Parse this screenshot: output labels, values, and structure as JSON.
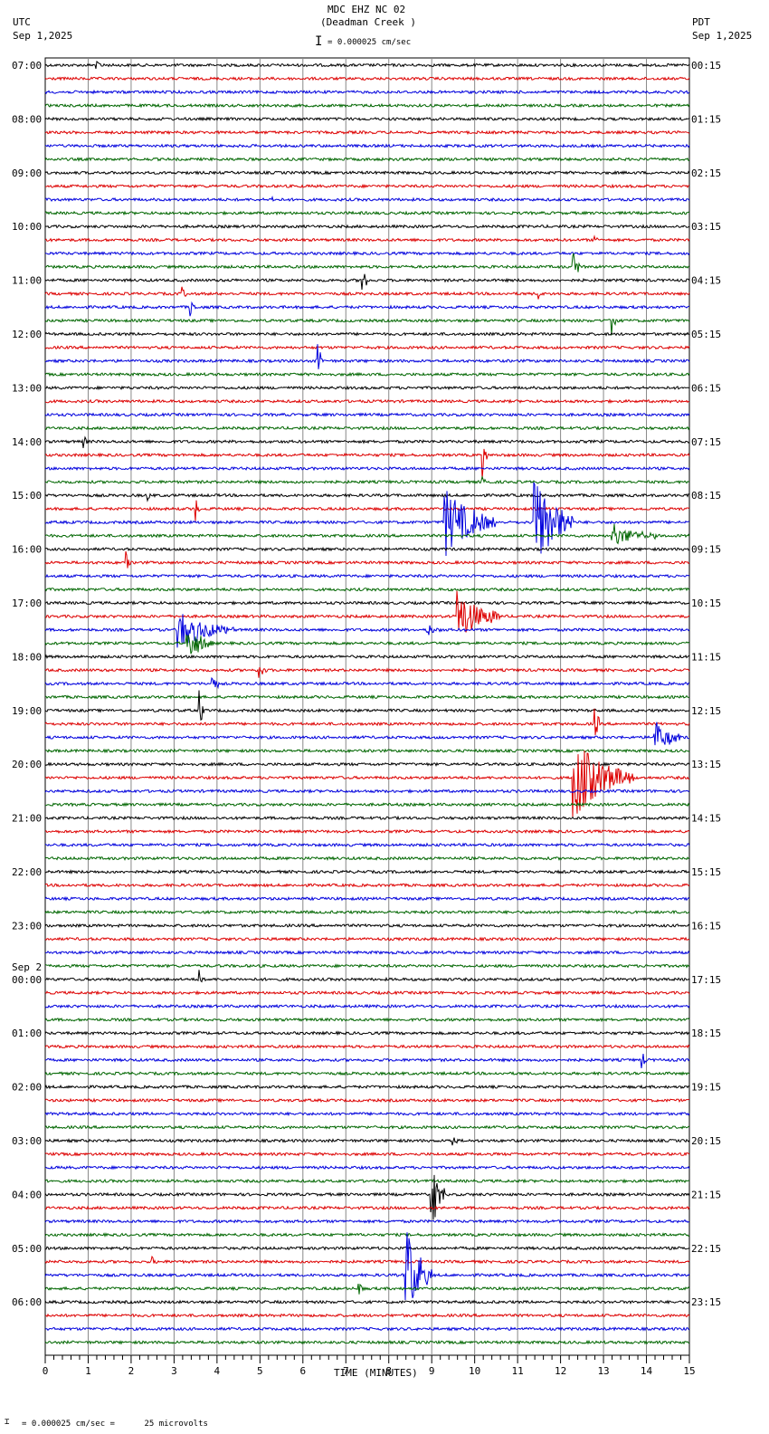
{
  "header": {
    "title": "MDC EHZ NC 02",
    "subtitle": "(Deadman Creek )",
    "scale": "= 0.000025 cm/sec",
    "left_tz": "UTC",
    "left_date": "Sep 1,2025",
    "right_tz": "PDT",
    "right_date": "Sep 1,2025"
  },
  "footer": {
    "scale": "= 0.000025 cm/sec =      25 microvolts"
  },
  "chart_data": {
    "type": "line",
    "title": "MDC EHZ NC 02 (Deadman Creek )",
    "xlabel": "TIME (MINUTES)",
    "xlim": [
      0,
      15
    ],
    "xticks": [
      "0",
      "1",
      "2",
      "3",
      "4",
      "5",
      "6",
      "7",
      "8",
      "9",
      "10",
      "11",
      "12",
      "13",
      "14",
      "15"
    ],
    "colors": [
      "#000000",
      "#dd0000",
      "#0000dd",
      "#006600"
    ],
    "left_labels": [
      "07:00",
      "08:00",
      "09:00",
      "10:00",
      "11:00",
      "12:00",
      "13:00",
      "14:00",
      "15:00",
      "16:00",
      "17:00",
      "18:00",
      "19:00",
      "20:00",
      "21:00",
      "22:00",
      "23:00",
      "00:00",
      "01:00",
      "02:00",
      "03:00",
      "04:00",
      "05:00",
      "06:00"
    ],
    "date_change": {
      "label": "Sep 2",
      "before_index": 17
    },
    "right_labels": [
      "00:15",
      "01:15",
      "02:15",
      "03:15",
      "04:15",
      "05:15",
      "06:15",
      "07:15",
      "08:15",
      "09:15",
      "10:15",
      "11:15",
      "12:15",
      "13:15",
      "14:15",
      "15:15",
      "16:15",
      "17:15",
      "18:15",
      "19:15",
      "20:15",
      "21:15",
      "22:15",
      "23:15"
    ],
    "traces_per_hour": 4,
    "events": [
      {
        "trace": 0,
        "minute": 1.2,
        "amp": 4,
        "dur": 0.2
      },
      {
        "trace": 10,
        "minute": 5.3,
        "amp": 5,
        "dur": 0.1
      },
      {
        "trace": 13,
        "minute": 12.8,
        "amp": 3,
        "dur": 0.2
      },
      {
        "trace": 15,
        "minute": 12.3,
        "amp": 22,
        "dur": 0.15
      },
      {
        "trace": 16,
        "minute": 7.4,
        "amp": 18,
        "dur": 0.1
      },
      {
        "trace": 17,
        "minute": 3.2,
        "amp": 7,
        "dur": 0.1
      },
      {
        "trace": 17,
        "minute": 11.5,
        "amp": 5,
        "dur": 0.1
      },
      {
        "trace": 18,
        "minute": 3.4,
        "amp": 8,
        "dur": 0.1
      },
      {
        "trace": 19,
        "minute": 13.2,
        "amp": 16,
        "dur": 0.1
      },
      {
        "trace": 22,
        "minute": 6.35,
        "amp": 18,
        "dur": 0.1
      },
      {
        "trace": 28,
        "minute": 0.9,
        "amp": 8,
        "dur": 0.1
      },
      {
        "trace": 29,
        "minute": 10.2,
        "amp": 18,
        "dur": 0.1
      },
      {
        "trace": 31,
        "minute": 10.2,
        "amp": 12,
        "dur": 0.1
      },
      {
        "trace": 32,
        "minute": 2.4,
        "amp": 5,
        "dur": 0.1
      },
      {
        "trace": 33,
        "minute": 3.5,
        "amp": 14,
        "dur": 0.1
      },
      {
        "trace": 34,
        "minute": 9.3,
        "amp": 40,
        "dur": 1.2
      },
      {
        "trace": 34,
        "minute": 11.4,
        "amp": 55,
        "dur": 0.9
      },
      {
        "trace": 35,
        "minute": 13.2,
        "amp": 14,
        "dur": 1.0
      },
      {
        "trace": 37,
        "minute": 1.9,
        "amp": 10,
        "dur": 0.1
      },
      {
        "trace": 41,
        "minute": 9.6,
        "amp": 30,
        "dur": 1.0
      },
      {
        "trace": 42,
        "minute": 3.1,
        "amp": 22,
        "dur": 1.3
      },
      {
        "trace": 42,
        "minute": 8.9,
        "amp": 8,
        "dur": 0.3
      },
      {
        "trace": 43,
        "minute": 3.3,
        "amp": 22,
        "dur": 0.6
      },
      {
        "trace": 45,
        "minute": 5.0,
        "amp": 7,
        "dur": 0.2
      },
      {
        "trace": 46,
        "minute": 3.9,
        "amp": 9,
        "dur": 0.2
      },
      {
        "trace": 48,
        "minute": 3.6,
        "amp": 20,
        "dur": 0.1
      },
      {
        "trace": 49,
        "minute": 12.8,
        "amp": 25,
        "dur": 0.1
      },
      {
        "trace": 50,
        "minute": 14.2,
        "amp": 20,
        "dur": 0.6
      },
      {
        "trace": 53,
        "minute": 12.3,
        "amp": 45,
        "dur": 1.4
      },
      {
        "trace": 68,
        "minute": 3.6,
        "amp": 10,
        "dur": 0.1
      },
      {
        "trace": 74,
        "minute": 13.9,
        "amp": 9,
        "dur": 0.1
      },
      {
        "trace": 80,
        "minute": 9.5,
        "amp": 10,
        "dur": 0.1
      },
      {
        "trace": 84,
        "minute": 9.0,
        "amp": 40,
        "dur": 0.3
      },
      {
        "trace": 89,
        "minute": 2.5,
        "amp": 5,
        "dur": 0.1
      },
      {
        "trace": 90,
        "minute": 8.4,
        "amp": 55,
        "dur": 0.6
      },
      {
        "trace": 91,
        "minute": 7.3,
        "amp": 10,
        "dur": 0.1
      }
    ]
  }
}
